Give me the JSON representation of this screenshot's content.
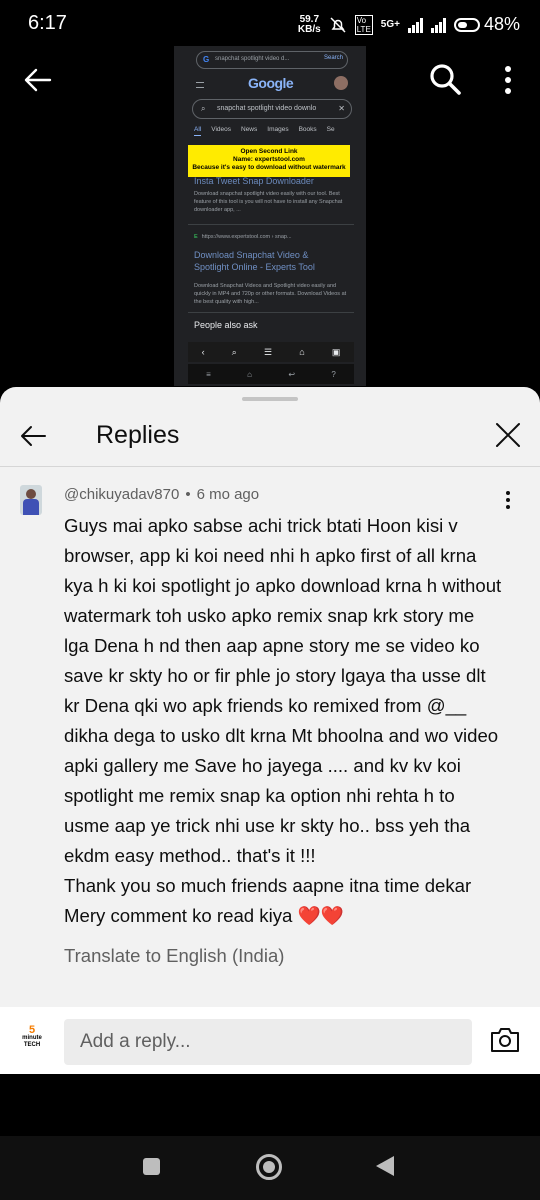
{
  "status_bar": {
    "time": "6:17",
    "net_speed_value": "59.7",
    "net_speed_unit": "KB/s",
    "network_label": "5G+",
    "battery": "48%"
  },
  "video": {
    "thumbnail": {
      "search_bar_text": "snapchat spotlight video d...",
      "search_button": "Search",
      "logo": "Google",
      "query": "snapchat spotlight video downlo",
      "tabs": [
        "All",
        "Videos",
        "News",
        "Images",
        "Books",
        "Se"
      ],
      "note_line1": "Open Second Link",
      "note_line2": "Name: expertstool.com",
      "note_line3": "Because it's easy to download without watermark",
      "result1_title": "Insta Tweet Snap Downloader",
      "result1_desc": "Download snapchat spotlight video easily with our tool. Best feature of this tool is you will not have to install any Snapchat downloader app, ...",
      "result2_url": "https://www.expertstool.com › snap...",
      "result2_title": "Download Snapchat Video & Spotlight Online - Experts Tool",
      "result2_desc": "Download Snapchat Videos and Spotlight video easily and quickly in MP4 and 720p or other formats. Download Videos at the best quality with high...",
      "people_also_ask": "People also ask"
    }
  },
  "panel": {
    "title": "Replies",
    "comment": {
      "author": "@chikuyadav870",
      "separator": "•",
      "time": "6 mo ago",
      "text": "Guys mai apko sabse achi trick btati Hoon kisi v browser, app ki koi need nhi h apko first of all krna kya h ki koi spotlight jo apko download krna h without watermark toh usko apko remix snap krk story me lga Dena h nd then aap apne story me se video ko save kr skty ho or fir phle jo story lgaya tha usse dlt kr Dena qki wo apk friends ko remixed from @__ dikha dega to usko dlt krna Mt bhoolna and wo video apki gallery me Save ho jayega .... and kv kv koi spotlight me remix snap ka option nhi rehta h to usme aap ye trick nhi use kr skty ho.. bss yeh tha ekdm easy method.. that's it !!!\nThank you so much friends aapne itna time dekar Mery comment ko read kiya ❤️❤️",
      "translate_label": "Translate to English (India)"
    },
    "reply_bar": {
      "avatar_top": "5",
      "avatar_mid": "minute",
      "avatar_bottom": "TECH",
      "placeholder": "Add a reply..."
    }
  },
  "icons": {
    "back": "arrow-left-icon",
    "search": "search-icon",
    "more": "more-vert-icon",
    "close": "close-icon",
    "camera": "camera-icon"
  }
}
